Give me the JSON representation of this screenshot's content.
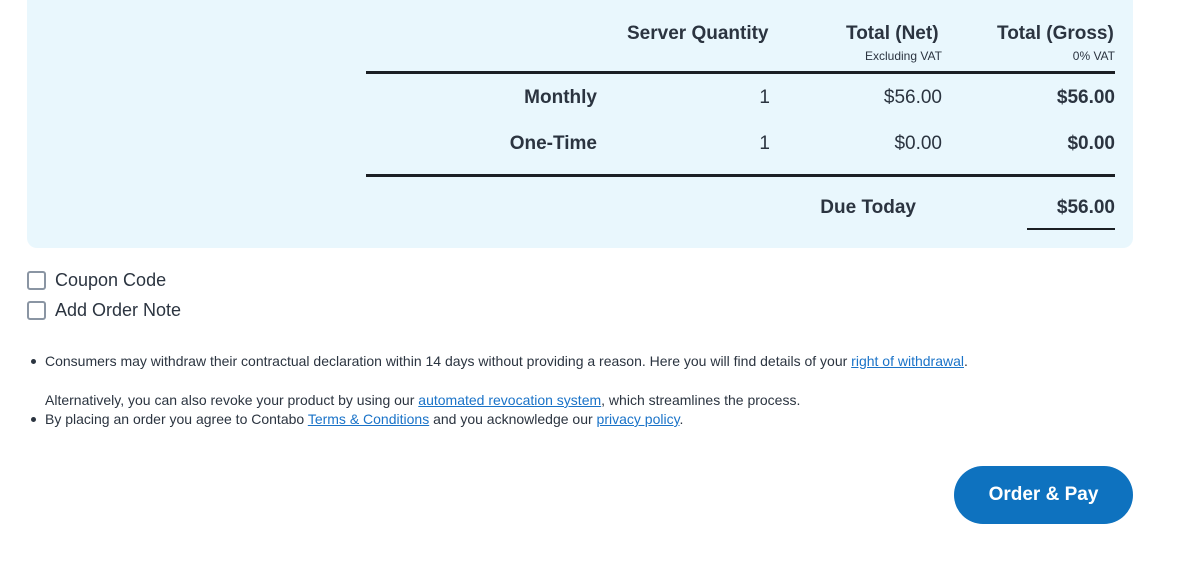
{
  "table": {
    "headers": {
      "quantity": "Server Quantity",
      "net": "Total (Net)",
      "net_sub": "Excluding VAT",
      "gross": "Total (Gross)",
      "gross_sub": "0% VAT"
    },
    "rows": [
      {
        "label": "Monthly",
        "quantity": "1",
        "net": "$56.00",
        "gross": "$56.00"
      },
      {
        "label": "One-Time",
        "quantity": "1",
        "net": "$0.00",
        "gross": "$0.00"
      }
    ],
    "due_today_label": "Due Today",
    "due_today_value": "$56.00"
  },
  "options": {
    "coupon_label": "Coupon Code",
    "note_label": "Add Order Note"
  },
  "legal": {
    "withdraw_text": "Consumers may withdraw their contractual declaration within 14 days without providing a reason. Here you will find details of your ",
    "withdraw_link": "right of withdrawal",
    "withdraw_end": ".",
    "revoke_text": "Alternatively, you can also revoke your product by using our ",
    "revoke_link": "automated revocation system",
    "revoke_end": ", which streamlines the process.",
    "agree_text": "By placing an order you agree to Contabo ",
    "terms_link": "Terms & Conditions",
    "agree_mid": " and you acknowledge our ",
    "privacy_link": "privacy policy",
    "agree_end": "."
  },
  "actions": {
    "order_label": "Order & Pay"
  },
  "colors": {
    "panel_bg": "#e9f7fd",
    "primary_button": "#0e72bf",
    "link": "#1a73c8"
  }
}
